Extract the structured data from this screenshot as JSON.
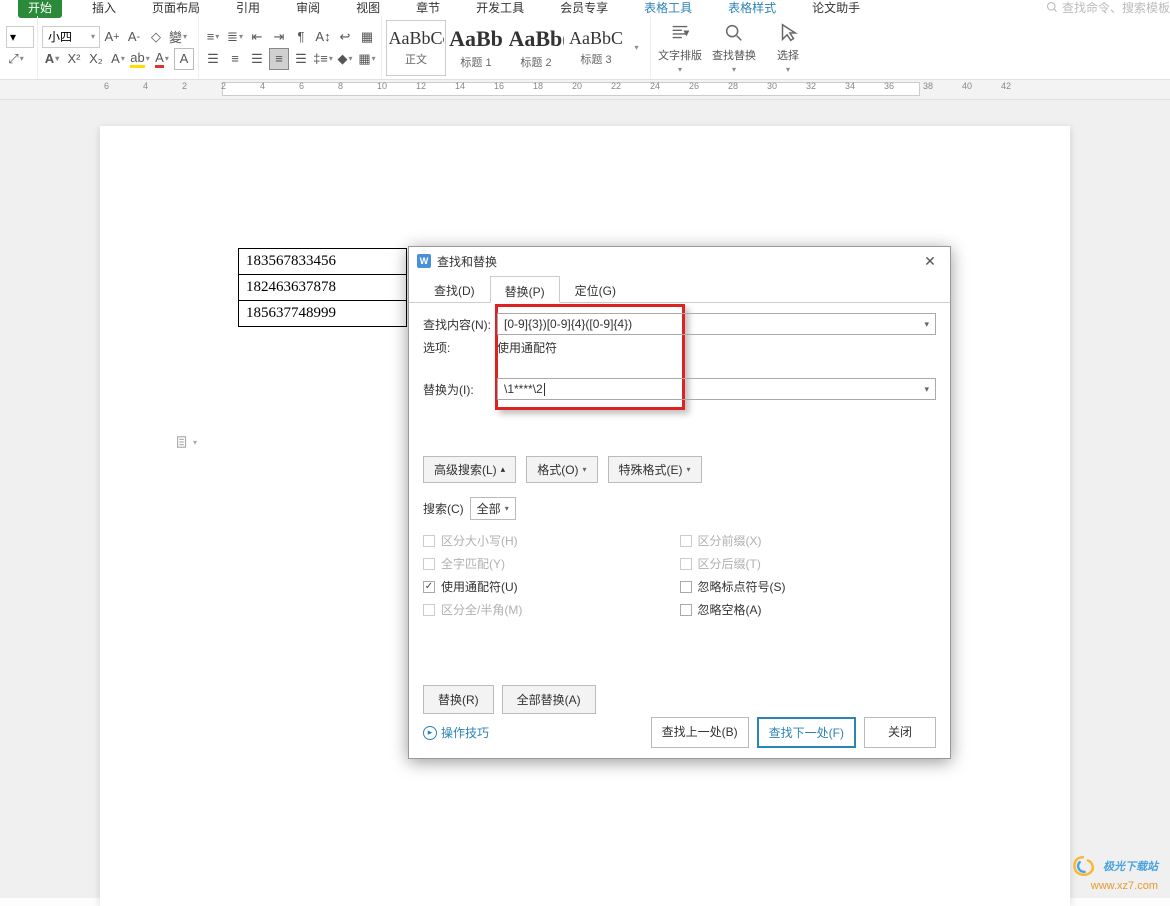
{
  "tabs": {
    "start": "开始",
    "insert": "插入",
    "layout": "页面布局",
    "references": "引用",
    "review": "审阅",
    "view": "视图",
    "section": "章节",
    "devtools": "开发工具",
    "member": "会员专享",
    "tabletools": "表格工具",
    "tablestyle": "表格样式",
    "paperhelper": "论文助手",
    "searchHint": "查找命令、搜索模板"
  },
  "ribbon": {
    "fontSize": "小四",
    "style1": {
      "preview": "AaBbCcD",
      "label": "正文"
    },
    "style2": {
      "preview": "AaBb",
      "label": "标题 1"
    },
    "style3": {
      "preview": "AaBb(",
      "label": "标题 2"
    },
    "style4": {
      "preview": "AaBbC",
      "label": "标题 3"
    },
    "textLayout": "文字排版",
    "findReplace": "查找替换",
    "select": "选择"
  },
  "ruler": {
    "nums": [
      "6",
      "4",
      "2",
      "2",
      "4",
      "6",
      "8",
      "10",
      "12",
      "14",
      "16",
      "18",
      "20",
      "22",
      "24",
      "26",
      "28",
      "30",
      "32",
      "34",
      "36",
      "38",
      "40",
      "42"
    ]
  },
  "doc": {
    "cells": [
      "183567833456",
      "182463637878",
      "185637748999"
    ]
  },
  "dialog": {
    "title": "查找和替换",
    "tabs": {
      "find": "查找(D)",
      "replace": "替换(P)",
      "goto": "定位(G)"
    },
    "findLabel": "查找内容(N):",
    "findValue": "[0-9]{3})[0-9]{4}([0-9]{4})",
    "optionsLabel": "选项:",
    "optionsValue": "使用通配符",
    "replaceLabel": "替换为(I):",
    "replaceValue": "\\1****\\2",
    "advSearch": "高级搜索(L)",
    "format": "格式(O)",
    "specialFmt": "特殊格式(E)",
    "searchScopeLabel": "搜索(C)",
    "searchScopeValue": "全部",
    "chk": {
      "matchCase": "区分大小写(H)",
      "wholeWord": "全字匹配(Y)",
      "wildcard": "使用通配符(U)",
      "fullHalf": "区分全/半角(M)",
      "prefix": "区分前缀(X)",
      "suffix": "区分后缀(T)",
      "ignorePunct": "忽略标点符号(S)",
      "ignoreSpace": "忽略空格(A)"
    },
    "replaceBtn": "替换(R)",
    "replaceAllBtn": "全部替换(A)",
    "tips": "操作技巧",
    "findPrev": "查找上一处(B)",
    "findNext": "查找下一处(F)",
    "close": "关闭"
  },
  "watermark": {
    "line1": "极光下载站",
    "line2": "www.xz7.com"
  }
}
